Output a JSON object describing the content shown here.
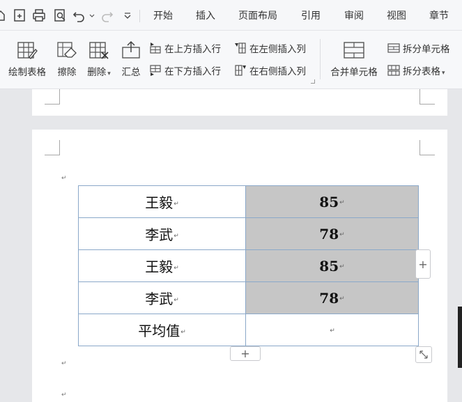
{
  "menu": {
    "tabs": [
      "开始",
      "插入",
      "页面布局",
      "引用",
      "审阅",
      "视图",
      "章节"
    ]
  },
  "ribbon": {
    "draw_table": "绘制表格",
    "eraser": "擦除",
    "delete": "删除",
    "summary": "汇总",
    "insert_above": "在上方插入行",
    "insert_below": "在下方插入行",
    "insert_left": "在左侧插入列",
    "insert_right": "在右侧插入列",
    "merge_cells": "合并单元格",
    "split_cells": "拆分单元格",
    "split_table": "拆分表格"
  },
  "table": {
    "rows": [
      {
        "name": "王毅",
        "score": "85"
      },
      {
        "name": "李武",
        "score": "78"
      },
      {
        "name": "王毅",
        "score": "85"
      },
      {
        "name": "李武",
        "score": "78"
      },
      {
        "name": "平均值",
        "score": ""
      }
    ]
  },
  "controls": {
    "add_col": "+",
    "add_row": "+"
  },
  "marks": {
    "para": "↵"
  }
}
